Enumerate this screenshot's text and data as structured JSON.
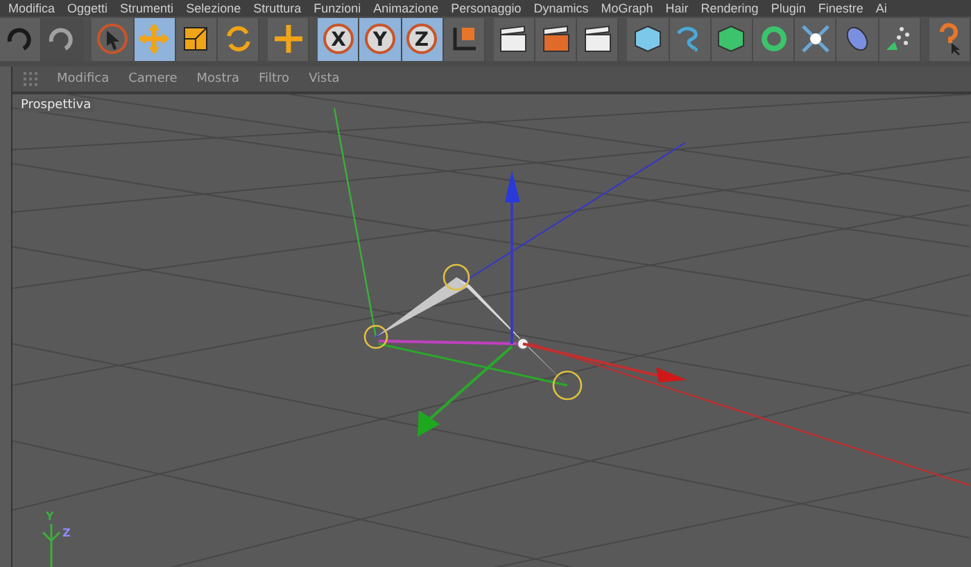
{
  "menu_bar": [
    "Modifica",
    "Oggetti",
    "Strumenti",
    "Selezione",
    "Struttura",
    "Funzioni",
    "Animazione",
    "Personaggio",
    "Dynamics",
    "MoGraph",
    "Hair",
    "Rendering",
    "Plugin",
    "Finestre",
    "Ai"
  ],
  "toolbar": [
    {
      "kind": "undo",
      "selected": false,
      "disabled": false
    },
    {
      "kind": "redo",
      "selected": false,
      "disabled": true
    },
    {
      "kind": "select",
      "selected": false,
      "disabled": false
    },
    {
      "kind": "move",
      "selected": true,
      "disabled": false
    },
    {
      "kind": "scale",
      "selected": false,
      "disabled": false
    },
    {
      "kind": "rotate",
      "selected": false,
      "disabled": false
    },
    {
      "kind": "add",
      "selected": false,
      "disabled": false
    },
    {
      "kind": "x",
      "selected": true,
      "disabled": false,
      "label": "X"
    },
    {
      "kind": "y",
      "selected": true,
      "disabled": false,
      "label": "Y"
    },
    {
      "kind": "z",
      "selected": true,
      "disabled": false,
      "label": "Z"
    },
    {
      "kind": "coords",
      "selected": false,
      "disabled": false
    },
    {
      "kind": "render-view",
      "selected": false,
      "disabled": false
    },
    {
      "kind": "render",
      "selected": false,
      "disabled": false
    },
    {
      "kind": "render-settings",
      "selected": false,
      "disabled": false
    },
    {
      "kind": "cube",
      "selected": false,
      "disabled": false
    },
    {
      "kind": "spline",
      "selected": false,
      "disabled": false
    },
    {
      "kind": "nurbs",
      "selected": false,
      "disabled": false
    },
    {
      "kind": "array",
      "selected": false,
      "disabled": false
    },
    {
      "kind": "deformer",
      "selected": false,
      "disabled": false
    },
    {
      "kind": "environment",
      "selected": false,
      "disabled": false
    },
    {
      "kind": "particles",
      "selected": false,
      "disabled": false
    },
    {
      "kind": "help",
      "selected": false,
      "disabled": false
    }
  ],
  "viewport": {
    "menu": [
      "Modifica",
      "Camere",
      "Mostra",
      "Filtro",
      "Vista"
    ],
    "label": "Prospettiva",
    "axis_labels": [
      "Y",
      "Z"
    ]
  }
}
